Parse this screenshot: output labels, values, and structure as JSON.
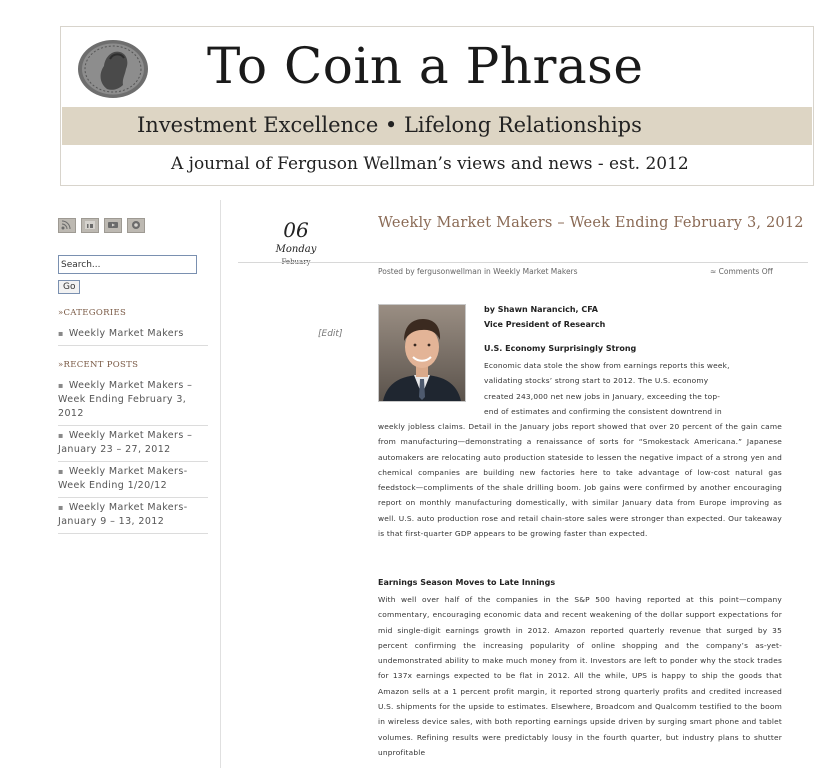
{
  "header": {
    "title": "To Coin a Phrase",
    "tagline": "Investment Excellence • Lifelong Relationships",
    "subtitle": "A journal of Ferguson Wellman’s views and news - est. 2012"
  },
  "sidebar": {
    "social_icons": [
      "rss-icon",
      "linkedin-icon",
      "youtube-icon",
      "email-icon"
    ],
    "search": {
      "value": "Search...",
      "button": "Go"
    },
    "categories_heading": "»Categories",
    "categories": [
      "Weekly Market Makers"
    ],
    "recent_heading": "»Recent Posts",
    "recent_posts": [
      "Weekly Market Makers – Week Ending February 3, 2012",
      "Weekly Market Makers – January 23 – 27, 2012",
      "Weekly Market Makers- Week Ending 1/20/12",
      "Weekly Market Makers- January 9 – 13, 2012"
    ]
  },
  "post": {
    "date_num": "06",
    "date_day": "Monday",
    "date_month": "Febuary",
    "edit": "[Edit]",
    "title": "Weekly Market Makers – Week Ending February 3, 2012",
    "meta": "Posted by fergusonwellman in Weekly Market Makers",
    "comments": "≈ Comments Off",
    "byline_name": "by Shawn Narancich, CFA",
    "byline_role": "Vice President of Research",
    "section1_head": "U.S. Economy Surprisingly Strong",
    "section1_lines": [
      "Economic data stole the show from earnings reports this week,",
      "validating stocks’ strong start to 2012. The U.S. economy",
      "created 243,000 net new jobs in January, exceeding the top-",
      "end of estimates and confirming the consistent downtrend in"
    ],
    "section1_rest": "weekly jobless claims. Detail in the January jobs report showed that over 20 percent of the gain came from manufacturing—demonstrating a renaissance of sorts for “Smokestack Americana.” Japanese automakers are relocating auto production stateside to lessen the negative impact of a strong yen and chemical companies are building new factories here to take advantage of low-cost natural gas feedstock—compliments of the shale drilling boom. Job gains were confirmed by another encouraging report on monthly manufacturing domestically, with similar January data from Europe improving as well. U.S. auto production rose and retail chain-store sales were stronger than expected. Our takeaway is that first-quarter GDP appears to be growing faster than expected.",
    "section2_head": "Earnings Season Moves to Late Innings",
    "section2_text": "With well over half of the companies in the S&P 500 having reported at this point—company commentary, encouraging economic data and recent weakening of the dollar support expectations for mid single-digit earnings growth in 2012. Amazon reported quarterly revenue that surged by 35 percent confirming the increasing popularity of online shopping and the company’s as-yet-undemonstrated ability to make much money from it. Investors are left to ponder why the stock trades for 137x earnings expected to be flat in 2012. All the while, UPS is happy to ship the goods that Amazon sells at a 1 percent profit margin, it reported strong quarterly profits and credited increased U.S. shipments for the upside to estimates. Elsewhere, Broadcom and Qualcomm testified to the boom in wireless device sales, with both reporting earnings upside driven by surging smart phone and tablet volumes. Refining results were predictably lousy in the fourth quarter, but industry plans to shutter unprofitable"
  }
}
